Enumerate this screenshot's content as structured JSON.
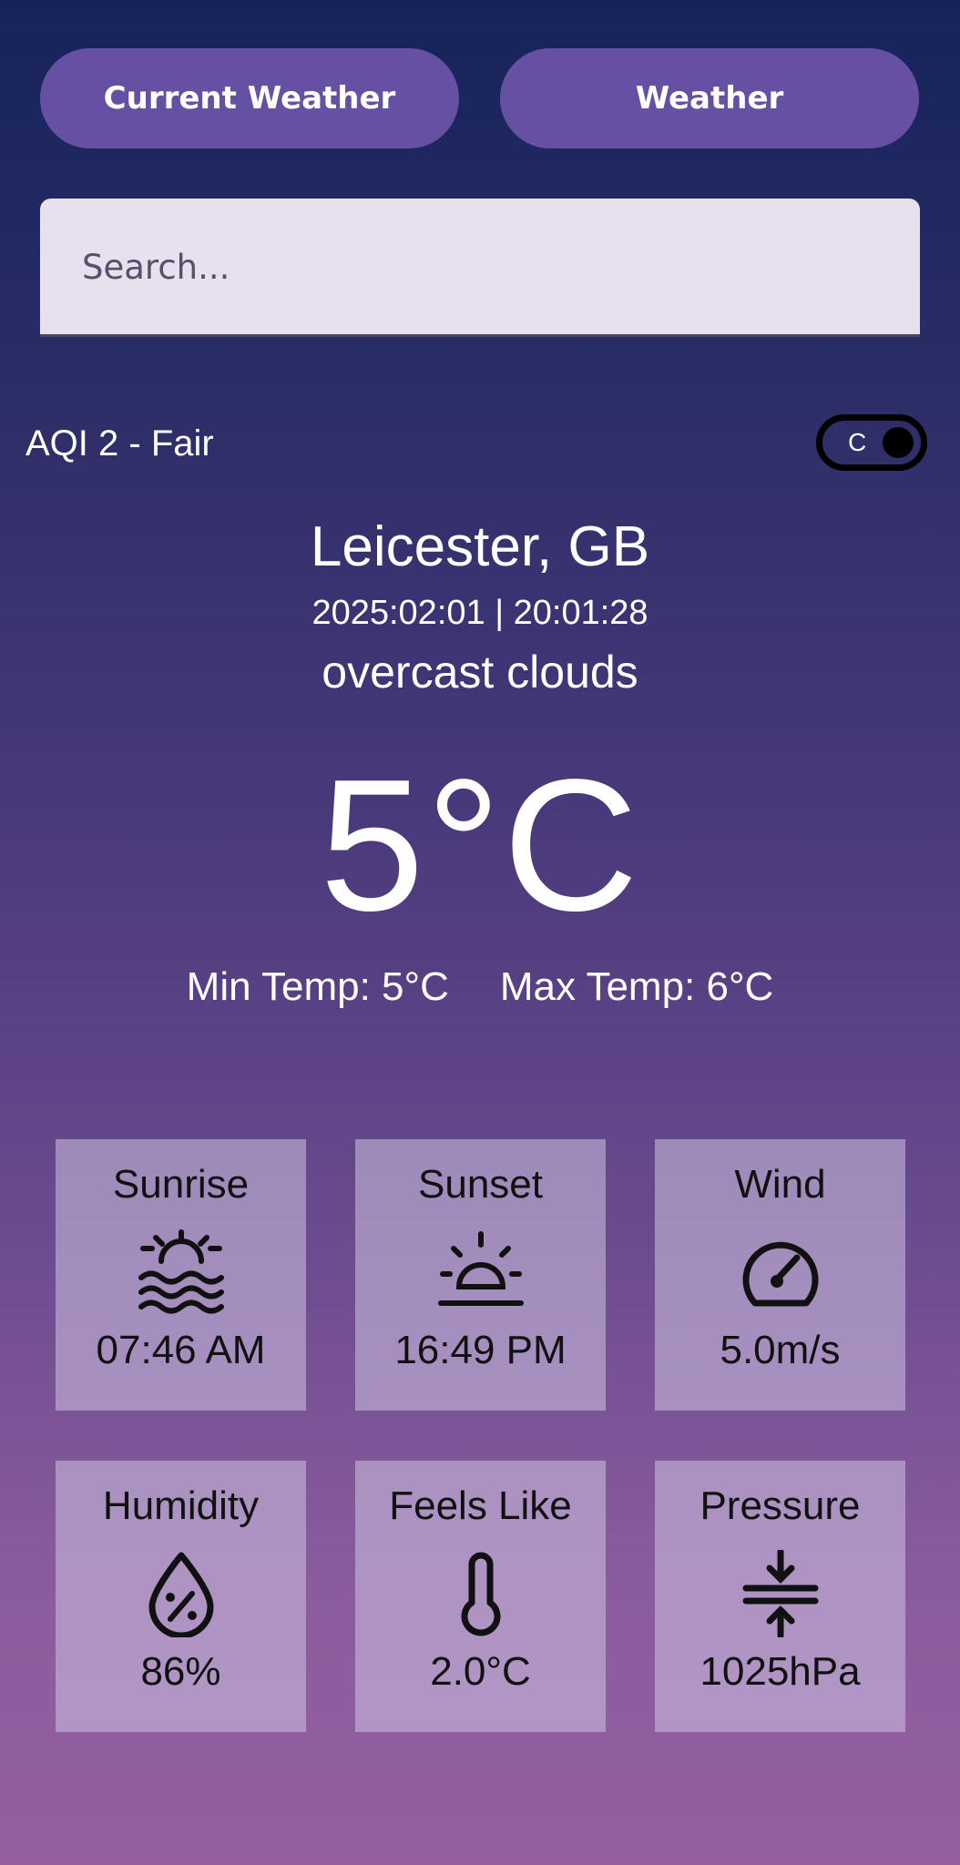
{
  "nav": {
    "current_weather_label": "Current Weather",
    "weather_label": "Weather"
  },
  "search": {
    "placeholder": "Search...",
    "value": ""
  },
  "aqi": {
    "text": "AQI 2 - Fair"
  },
  "unit_toggle": {
    "label": "C"
  },
  "location": {
    "city": "Leicester, GB",
    "datetime": "2025:02:01 | 20:01:28",
    "condition": "overcast clouds"
  },
  "temperature": {
    "current": "5°C",
    "min": "Min Temp: 5°C",
    "max": "Max Temp: 6°C"
  },
  "tiles": [
    {
      "title": "Sunrise",
      "value": "07:46 AM",
      "icon": "sunrise-icon"
    },
    {
      "title": "Sunset",
      "value": "16:49 PM",
      "icon": "sunset-icon"
    },
    {
      "title": "Wind",
      "value": "5.0m/s",
      "icon": "speedometer-icon"
    },
    {
      "title": "Humidity",
      "value": "86%",
      "icon": "humidity-drop-icon"
    },
    {
      "title": "Feels Like",
      "value": "2.0°C",
      "icon": "thermometer-icon"
    },
    {
      "title": "Pressure",
      "value": "1025hPa",
      "icon": "pressure-arrows-icon"
    }
  ],
  "colors": {
    "button_bg": "#6650a4",
    "search_bg": "#e8e0ee",
    "gradient_top": "#16235a",
    "gradient_bottom": "#955fa0",
    "tile_bg": "#cdc3e1"
  }
}
